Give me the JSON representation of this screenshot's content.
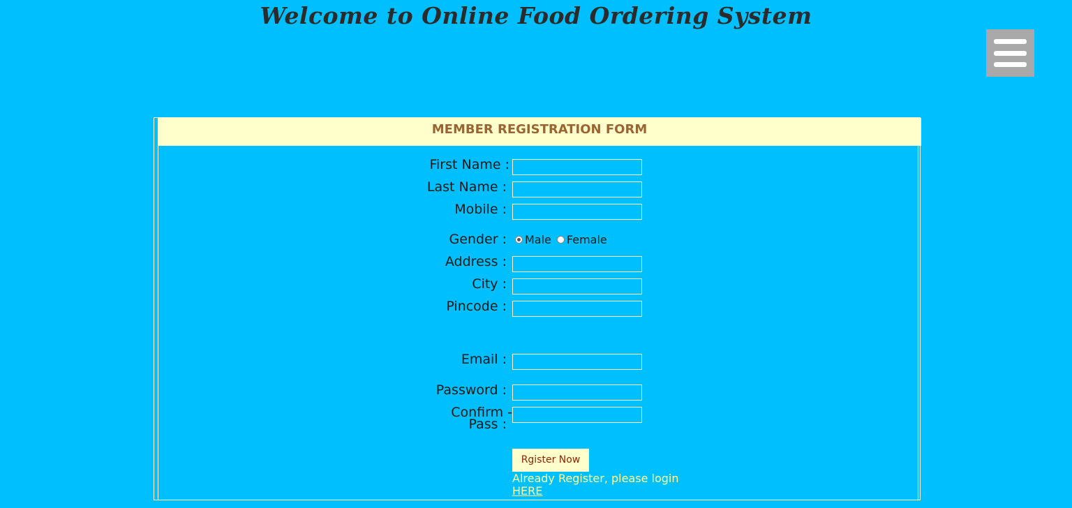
{
  "header": {
    "title": "Welcome to Online Food Ordering System",
    "menu_icon": "hamburger-menu-icon"
  },
  "form": {
    "title": "MEMBER REGISTRATION FORM",
    "fields": {
      "first_name": {
        "label": "First Name :",
        "value": ""
      },
      "last_name": {
        "label": "Last Name :",
        "value": ""
      },
      "mobile": {
        "label": "Mobile :",
        "value": ""
      },
      "gender": {
        "label": "Gender :",
        "options": [
          "Male",
          "Female"
        ],
        "selected": "Male"
      },
      "address": {
        "label": "Address :",
        "value": ""
      },
      "city": {
        "label": "City :",
        "value": ""
      },
      "pincode": {
        "label": "Pincode :",
        "value": ""
      },
      "email": {
        "label": "Email :",
        "value": ""
      },
      "password": {
        "label": "Password :",
        "value": ""
      },
      "confirm_pass": {
        "label_line1": "Confirm -",
        "label_line2": "Pass :",
        "value": ""
      }
    },
    "submit_label": "Rgister Now",
    "login_prompt": "Already Register, please login",
    "login_link": "HERE"
  },
  "colors": {
    "background": "#00bfff",
    "header_band": "#ffffcc",
    "header_text": "#996633",
    "menu_button": "#a9a9a9",
    "link": "#ffff99"
  }
}
